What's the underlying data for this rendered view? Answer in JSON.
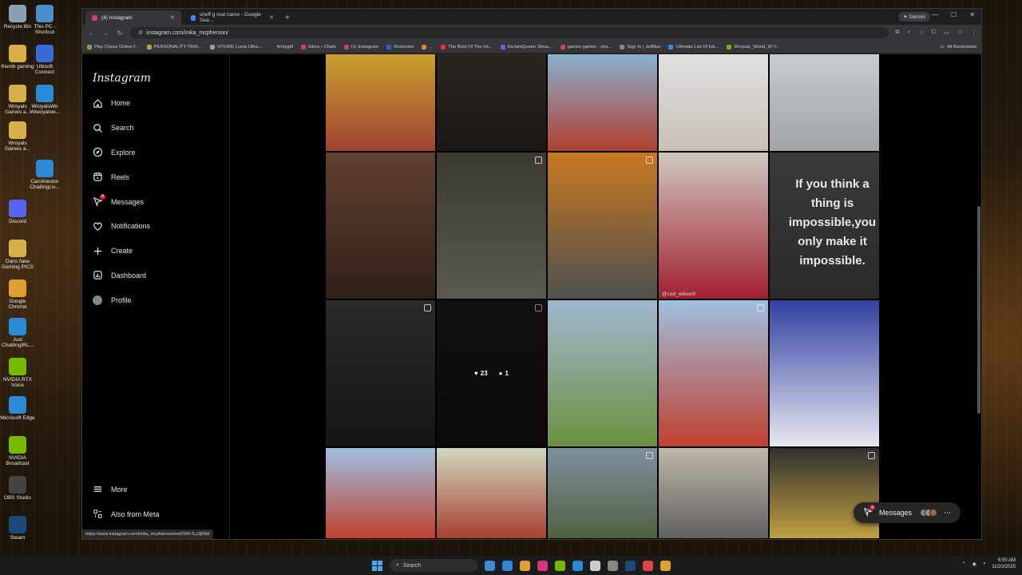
{
  "desktop": {
    "icons": [
      {
        "label": "Recycle Bin",
        "color": "#8aa0b8"
      },
      {
        "label": "This PC - Shortcut",
        "color": "#4a90c8"
      },
      {
        "label": "thumb gaming",
        "color": "#d8b04a"
      },
      {
        "label": "Ubisoft Connect",
        "color": "#3a6ad8"
      },
      {
        "label": "Wroyals Games a...",
        "color": "#d8b04a"
      },
      {
        "label": "WroyalsWo Wiwoyalsw...",
        "color": "#2a8ad8"
      },
      {
        "label": "Wroyals Games a...",
        "color": "#d8b04a"
      },
      {
        "label": "Carolinestor ChattingLiv...",
        "color": "#2a8ad8"
      },
      {
        "label": "Discord",
        "color": "#5865f2"
      },
      {
        "label": "Dans New Gaming PICS",
        "color": "#d8b04a"
      },
      {
        "label": "Google Chrome",
        "color": "#e0a030"
      },
      {
        "label": "Just ChattingIRL...",
        "color": "#2a8ad8"
      },
      {
        "label": "NVIDIA RTX Voice",
        "color": "#76b900"
      },
      {
        "label": "Microsoft Edge",
        "color": "#2a8ad8"
      },
      {
        "label": "NVIDIA Broadcast",
        "color": "#76b900"
      },
      {
        "label": "OBS Studio",
        "color": "#444"
      },
      {
        "label": "Steam",
        "color": "#1b4a7a"
      }
    ]
  },
  "browser": {
    "tabs": [
      {
        "title": "(4) Instagram",
        "active": true,
        "favicon_color": "#d6367a"
      },
      {
        "title": "sheff g real name - Google Sea...",
        "active": false,
        "favicon_color": "#4285f4"
      }
    ],
    "gemini_label": "Gemini",
    "url": "instagram.com/inika_mcpherson/",
    "bookmarks": [
      {
        "label": "Play Chess Online f...",
        "color": "#7fa650"
      },
      {
        "label": "PERSONALITY TRAI...",
        "color": "#c8a050"
      },
      {
        "label": "VITURE Luma Ultra...",
        "color": "#999"
      },
      {
        "label": "fentygirl",
        "color": "#333"
      },
      {
        "label": "Inbox • Chats",
        "color": "#d6367a"
      },
      {
        "label": "(1) Instagram",
        "color": "#d6367a"
      },
      {
        "label": "Restream",
        "color": "#3a5ad8"
      },
      {
        "label": "...",
        "color": "#e74"
      },
      {
        "label": "The Best Of The Int...",
        "color": "#e33"
      },
      {
        "label": "DeJamQueen Strea...",
        "color": "#9146ff"
      },
      {
        "label": "games games - sha...",
        "color": "#d44"
      },
      {
        "label": "Sign In | JetBlue",
        "color": "#888"
      },
      {
        "label": "Ultimate List Of Iok...",
        "color": "#3a8ad8"
      },
      {
        "label": "Wroyals_World_W V...",
        "color": "#76b900"
      }
    ],
    "all_bookmarks_label": "All Bookmarks",
    "status_url": "https://www.instagram.com/inika_mcpherson/reel/DRFJLy3j09d/"
  },
  "instagram": {
    "logo": "Instagram",
    "nav": [
      {
        "label": "Home",
        "icon": "home-icon"
      },
      {
        "label": "Search",
        "icon": "search-icon"
      },
      {
        "label": "Explore",
        "icon": "explore-icon"
      },
      {
        "label": "Reels",
        "icon": "reels-icon"
      },
      {
        "label": "Messages",
        "icon": "messages-icon",
        "badge": "4"
      },
      {
        "label": "Notifications",
        "icon": "heart-icon"
      },
      {
        "label": "Create",
        "icon": "plus-icon"
      },
      {
        "label": "Dashboard",
        "icon": "dashboard-icon"
      },
      {
        "label": "Profile",
        "icon": "avatar"
      }
    ],
    "more_label": "More",
    "also_from_meta_label": "Also from Meta",
    "grid": {
      "quote_text": "If you think a thing is impossible,you only make it impossible.",
      "tag_text": "@cod_wilson0",
      "hover_likes": "23",
      "hover_comments": "1",
      "posts": [
        {
          "colors": [
            "#c8a030",
            "#a04030"
          ],
          "reel": false
        },
        {
          "colors": [
            "#2a2520",
            "#1a1814"
          ],
          "reel": false
        },
        {
          "colors": [
            "#8ab0d0",
            "#b04030"
          ],
          "reel": false
        },
        {
          "colors": [
            "#e0e0e0",
            "#c8c0b8"
          ],
          "reel": false
        },
        {
          "colors": [
            "#c8ccd0",
            "#a0a4a8"
          ],
          "reel": false
        },
        {
          "colors": [
            "#604030",
            "#302018"
          ],
          "reel": false
        },
        {
          "colors": [
            "#3a3a30",
            "#5a5a50"
          ],
          "reel": true
        },
        {
          "colors": [
            "#c87820",
            "#505050"
          ],
          "reel": true
        },
        {
          "colors": [
            "#d0c8c0",
            "#a02030"
          ],
          "reel": false
        },
        {
          "colors": [
            "#3a3a3a",
            "#2a2a2a"
          ],
          "reel": false
        },
        {
          "colors": [
            "#2a2a2a",
            "#151515"
          ],
          "reel": true
        },
        {
          "colors": [
            "#1a1a1a",
            "#101010"
          ],
          "reel": true
        },
        {
          "colors": [
            "#a0b8d0",
            "#6a9040"
          ],
          "reel": false
        },
        {
          "colors": [
            "#a0c0e0",
            "#c04030"
          ],
          "reel": true
        },
        {
          "colors": [
            "#3040a0",
            "#e8e8f0"
          ],
          "reel": false
        },
        {
          "colors": [
            "#a0c0e0",
            "#c04030"
          ],
          "reel": false
        },
        {
          "colors": [
            "#d0d8c0",
            "#a84030"
          ],
          "reel": false
        },
        {
          "colors": [
            "#8090a0",
            "#506040"
          ],
          "reel": true
        },
        {
          "colors": [
            "#c0b8a8",
            "#606060"
          ],
          "reel": false
        },
        {
          "colors": [
            "#303030",
            "#c0a040"
          ],
          "reel": true
        }
      ]
    },
    "messages_pill_label": "Messages",
    "messages_pill_badge": "4"
  },
  "taskbar": {
    "search_placeholder": "Search",
    "apps": [
      "#3a8ad8",
      "#2a8ad8",
      "#e0a030",
      "#d6367a",
      "#76b900",
      "#2a8ad8",
      "#ccc",
      "#888",
      "#1b4a7a",
      "#d44",
      "#e0a030"
    ],
    "time": "6:50 AM",
    "date": "11/20/2025"
  }
}
